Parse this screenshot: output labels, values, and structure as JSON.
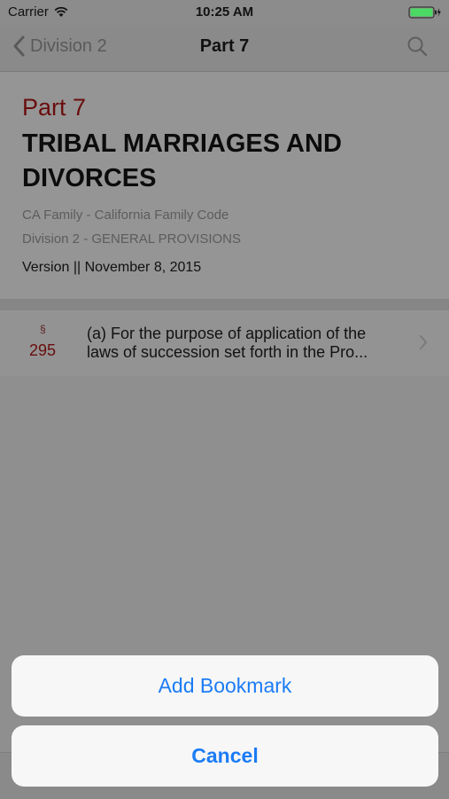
{
  "status_bar": {
    "carrier": "Carrier",
    "time": "10:25 AM"
  },
  "nav": {
    "back_label": "Division 2",
    "title": "Part 7"
  },
  "header": {
    "part_label": "Part 7",
    "title_lines": [
      "TRIBAL MARRIAGES AND",
      "DIVORCES"
    ],
    "code_name": "CA Family - California Family Code",
    "division": "Division 2 - GENERAL PROVISIONS",
    "version": "Version || November 8, 2015"
  },
  "sections": [
    {
      "symbol": "§",
      "number": "295",
      "excerpt_lines": [
        "(a) For the purpose of application of the",
        "laws of succession set forth in the Pro..."
      ]
    }
  ],
  "action_sheet": {
    "add_bookmark": "Add Bookmark",
    "cancel": "Cancel"
  },
  "colors": {
    "accent": "#1b7cf5",
    "part_red": "#6a0d0d"
  }
}
